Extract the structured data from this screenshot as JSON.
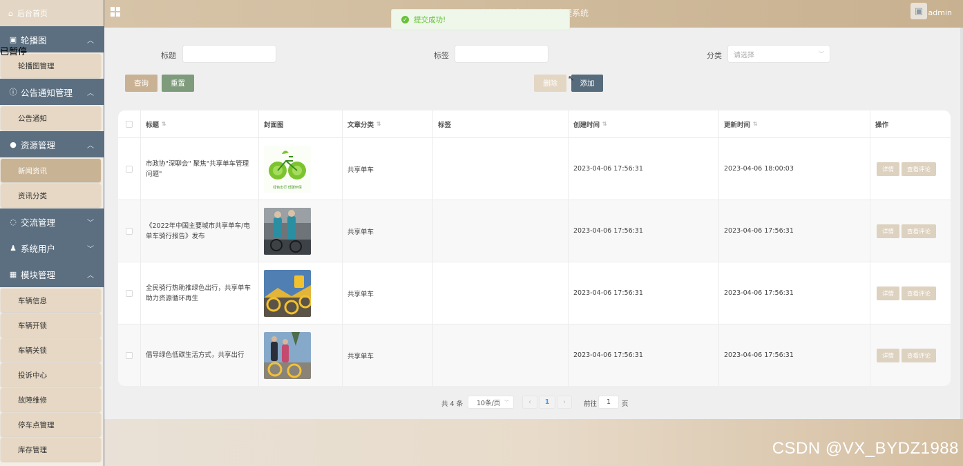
{
  "header": {
    "title": "新能源共享单车租赁管理系统",
    "user": "admin"
  },
  "toast": {
    "message": "提交成功!"
  },
  "sidebar": {
    "home": "后台首页",
    "paused": "已暂停",
    "groups": [
      {
        "label": "轮播图",
        "items": [
          "轮播图管理"
        ]
      },
      {
        "label": "公告通知管理",
        "items": [
          "公告通知"
        ]
      },
      {
        "label": "资源管理",
        "items": [
          "新闻资讯",
          "资讯分类"
        ]
      },
      {
        "label": "交流管理",
        "items": []
      },
      {
        "label": "系统用户",
        "items": []
      },
      {
        "label": "模块管理",
        "items": [
          "车辆信息",
          "车辆开锁",
          "车辆关锁",
          "投诉中心",
          "故障维修",
          "停车点管理",
          "库存管理"
        ]
      }
    ]
  },
  "filters": {
    "title_label": "标题",
    "tag_label": "标签",
    "category_label": "分类",
    "category_placeholder": "请选择"
  },
  "buttons": {
    "query": "查询",
    "reset": "重置",
    "delete": "删除",
    "add": "添加"
  },
  "table": {
    "headers": [
      "标题",
      "封面图",
      "文章分类",
      "标签",
      "创建时间",
      "更新时间",
      "操作"
    ],
    "rows": [
      {
        "title": "市政协\"深聊会\" 聚焦\"共享单车管理问题\"",
        "category": "共享单车",
        "tag": "",
        "created": "2023-04-06 17:56:31",
        "updated": "2023-04-06 18:00:03"
      },
      {
        "title": "《2022年中国主要城市共享单车/电单车骑行报告》发布",
        "category": "共享单车",
        "tag": "",
        "created": "2023-04-06 17:56:31",
        "updated": "2023-04-06 17:56:31"
      },
      {
        "title": "全民骑行热助推绿色出行，共享单车助力资源循环再生",
        "category": "共享单车",
        "tag": "",
        "created": "2023-04-06 17:56:31",
        "updated": "2023-04-06 17:56:31"
      },
      {
        "title": "倡导绿色低碳生活方式，共享出行",
        "category": "共享单车",
        "tag": "",
        "created": "2023-04-06 17:56:31",
        "updated": "2023-04-06 17:56:31"
      }
    ],
    "op_detail": "详情",
    "op_comment": "查看评论",
    "thumb1_text": "绿色出行  低碳环保"
  },
  "pager": {
    "total": "共 4 条",
    "page_size": "10条/页",
    "current": "1",
    "goto_prefix": "前往",
    "goto_value": "1",
    "goto_suffix": "页"
  },
  "watermark": "CSDN @VX_BYDZ1988"
}
